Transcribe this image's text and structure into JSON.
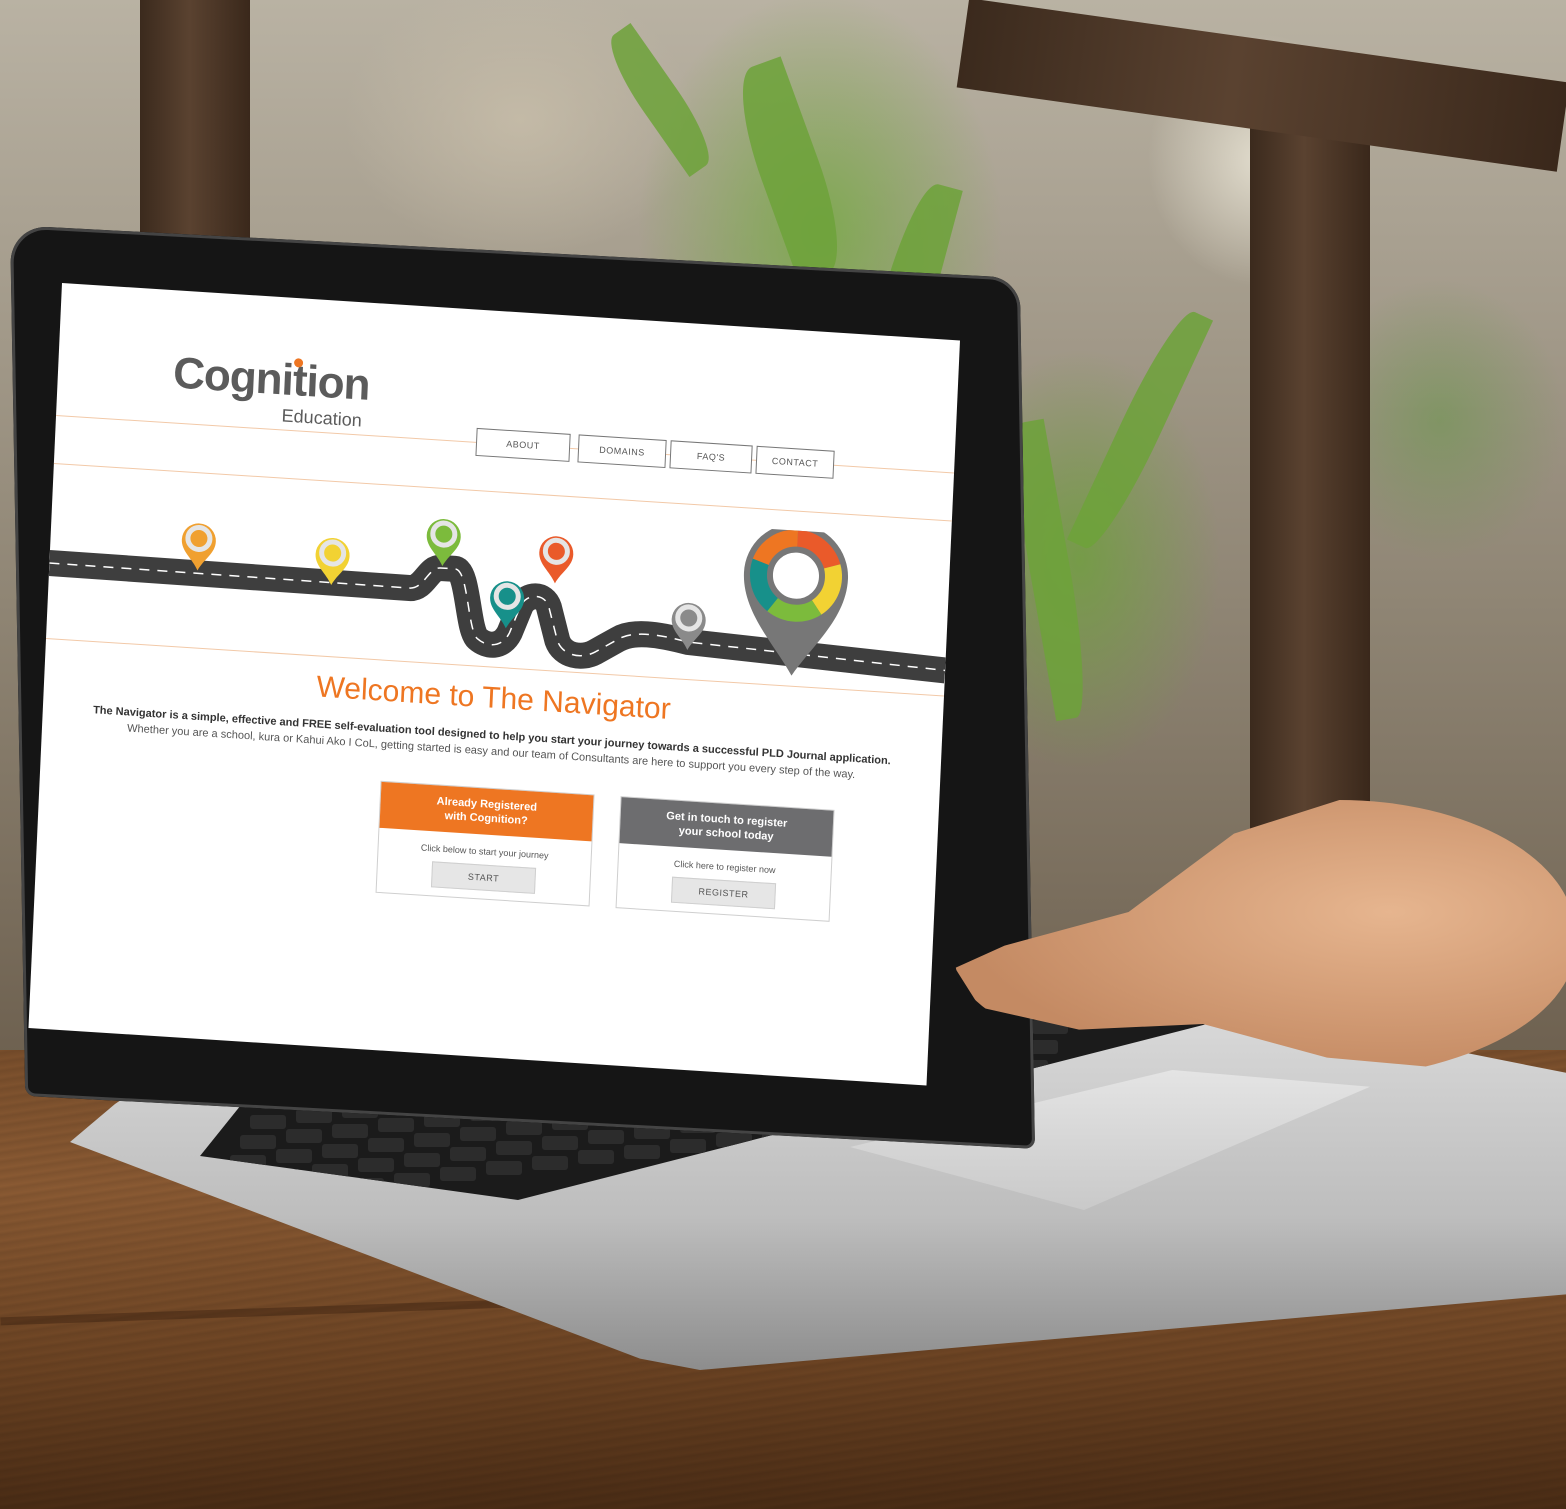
{
  "brand": {
    "name": "Cognition",
    "subtitle": "Education",
    "accent_color": "#ee7622",
    "text_color": "#5b5b5b"
  },
  "nav": {
    "items": [
      {
        "label": "ABOUT"
      },
      {
        "label": "DOMAINS"
      },
      {
        "label": "FAQ'S"
      },
      {
        "label": "CONTACT"
      }
    ]
  },
  "hero": {
    "marker_colors": [
      "#f0a030",
      "#f2d233",
      "#7cbb3c",
      "#17908a",
      "#ea5a2a",
      "#8a8a8a"
    ],
    "wheel_colors": [
      "#ea5a2a",
      "#f2d233",
      "#7cbb3c",
      "#17908a",
      "#ee7622"
    ]
  },
  "welcome": {
    "title": "Welcome to The Navigator",
    "intro_bold": "The Navigator is a simple, effective and FREE self-evaluation tool designed to help you start your journey towards a successful PLD Journal application.",
    "intro": "Whether you are a school, kura or Kahui Ako I CoL, getting started is easy and our team of Consultants are here to support you every step of the way."
  },
  "cards": {
    "registered": {
      "heading": "Already Registered\nwith Cognition?",
      "text": "Click below to start your journey",
      "button": "START",
      "color": "#ee7622"
    },
    "register": {
      "heading": "Get in touch to register\nyour school today",
      "text": "Click here to register now",
      "button": "REGISTER",
      "color": "#6d6d6f"
    }
  }
}
